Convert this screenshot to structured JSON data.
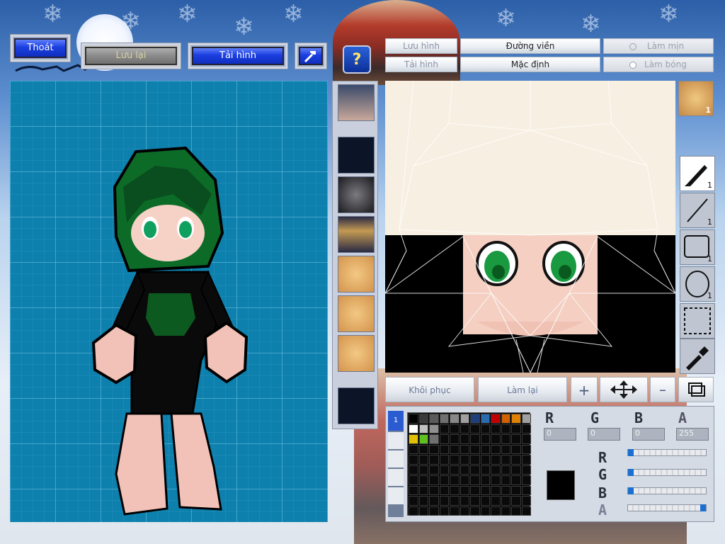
{
  "top_buttons": {
    "exit": "Thoát",
    "save": "Lưu lại",
    "reload": "Tải hình"
  },
  "tabs": {
    "save_image": "Lưu hình",
    "outline": "Đường viền",
    "smooth": "Làm mịn",
    "load_image": "Tải hình",
    "default": "Mặc định",
    "shade": "Làm bóng"
  },
  "tools": [
    {
      "name": "pen",
      "count": "1"
    },
    {
      "name": "line",
      "count": "1"
    },
    {
      "name": "rectangle",
      "count": "1"
    },
    {
      "name": "ellipse",
      "count": "1"
    },
    {
      "name": "selection",
      "count": ""
    },
    {
      "name": "eyedropper",
      "count": ""
    }
  ],
  "face_badge_count": "1",
  "bottom_buttons": {
    "restore": "Khôi phục",
    "redo": "Làm lại"
  },
  "color": {
    "r_value": "0",
    "g_value": "0",
    "b_value": "0",
    "a_value": "255",
    "r_label": "R",
    "g_label": "G",
    "b_label": "B",
    "a_label": "A",
    "current": "#000000"
  },
  "palette_colors": [
    "#000000",
    "#3a3a3a",
    "#5a5a5a",
    "#707070",
    "#888888",
    "#a0a0a0",
    "#1f3f7a",
    "#2a6bb0",
    "#c00000",
    "#d06000",
    "#e08000",
    "#a0a0a0",
    "#ffffff",
    "#c0c0c0",
    "#909090",
    "#0a0a0a",
    "#0a0a0a",
    "#0a0a0a",
    "#0a0a0a",
    "#0a0a0a",
    "#0a0a0a",
    "#0a0a0a",
    "#0a0a0a",
    "#0a0a0a",
    "#e0c000",
    "#60c020",
    "#707070"
  ],
  "palette_rows": 10,
  "palette_cols": 12
}
